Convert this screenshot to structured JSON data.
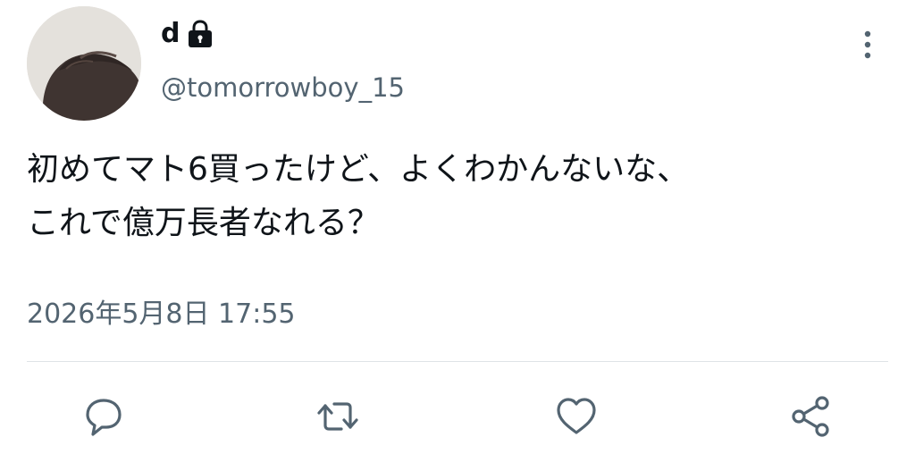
{
  "user": {
    "display_name": "d",
    "handle": "@tomorrowboy_15",
    "protected_icon": "lock-icon"
  },
  "tweet": {
    "text_lines": [
      "初めてマト6買ったけど、よくわかんないな、",
      "これで億万長者なれる？"
    ],
    "timestamp": "2026年5月8日 17:55"
  },
  "actions": {
    "reply_icon": "reply-icon",
    "retweet_icon": "retweet-icon",
    "like_icon": "heart-icon",
    "share_icon": "share-icon"
  },
  "colors": {
    "text": "#0f1419",
    "secondary": "#536471",
    "divider": "#dfe3e6"
  }
}
